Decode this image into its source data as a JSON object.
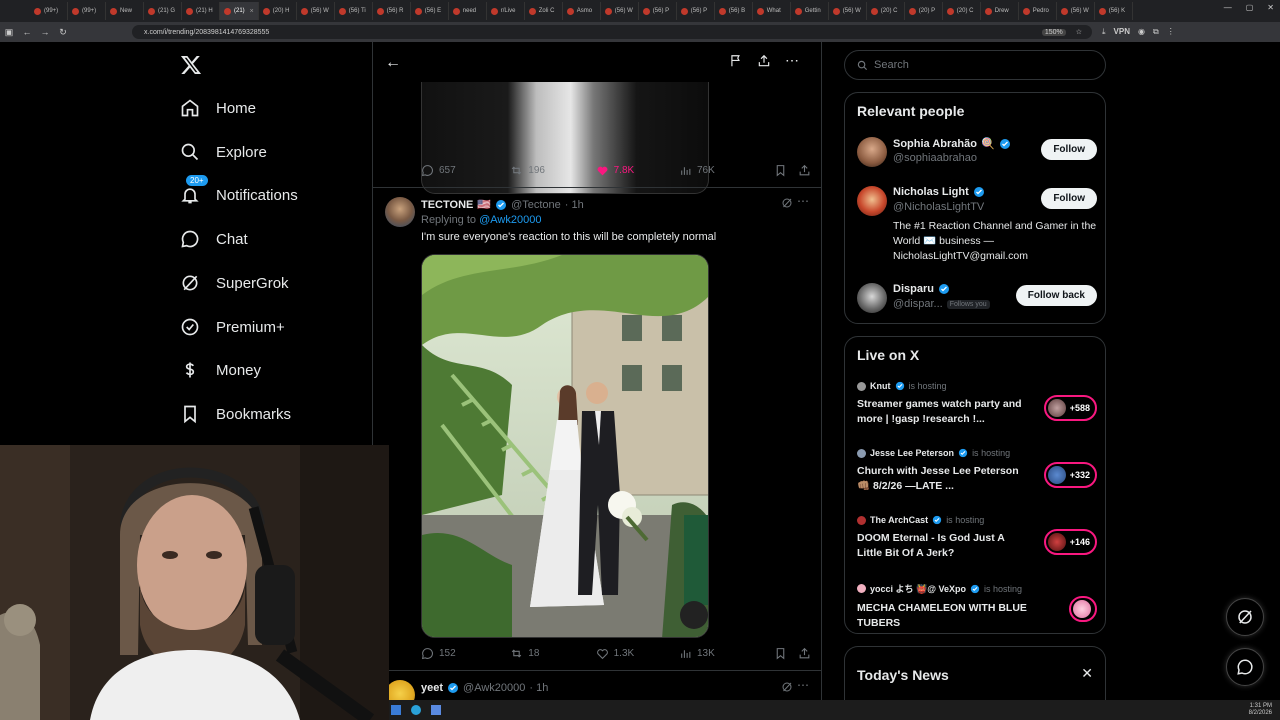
{
  "browser": {
    "tabs": [
      {
        "label": "(99+)"
      },
      {
        "label": "(99+)"
      },
      {
        "label": "New"
      },
      {
        "label": "(21) G"
      },
      {
        "label": "(21) H"
      },
      {
        "label": "(21)",
        "active": true
      },
      {
        "label": "(20) H"
      },
      {
        "label": "(56) W"
      },
      {
        "label": "(56) Ti"
      },
      {
        "label": "(56) R"
      },
      {
        "label": "(56) E"
      },
      {
        "label": "need"
      },
      {
        "label": "r/Live"
      },
      {
        "label": "Zoli C"
      },
      {
        "label": "Asmo"
      },
      {
        "label": "(56) W"
      },
      {
        "label": "(56) P"
      },
      {
        "label": "(56) P"
      },
      {
        "label": "(56) B"
      },
      {
        "label": "What"
      },
      {
        "label": "Gettin"
      },
      {
        "label": "(56) W"
      },
      {
        "label": "(20) C"
      },
      {
        "label": "(20) P"
      },
      {
        "label": "(20) C"
      },
      {
        "label": "Drew"
      },
      {
        "label": "Pedro"
      },
      {
        "label": "(56) W"
      },
      {
        "label": "(56) K"
      }
    ],
    "url": "x.com/i/trending/2083981414769328555",
    "zoom": "150%",
    "vpn": "VPN"
  },
  "nav": {
    "items": [
      {
        "label": "Home",
        "icon": "home-icon"
      },
      {
        "label": "Explore",
        "icon": "search-icon"
      },
      {
        "label": "Notifications",
        "icon": "bell-icon",
        "badge": "20+"
      },
      {
        "label": "Chat",
        "icon": "chat-icon"
      },
      {
        "label": "SuperGrok",
        "icon": "grok-icon"
      },
      {
        "label": "Premium+",
        "icon": "premium-icon"
      },
      {
        "label": "Money",
        "icon": "money-icon"
      },
      {
        "label": "Bookmarks",
        "icon": "bookmark-icon"
      }
    ]
  },
  "tweet1": {
    "replies": "657",
    "reposts": "196",
    "likes": "7.8K",
    "views": "76K"
  },
  "tweet2": {
    "name": "TECTONE",
    "flag": "🇺🇸",
    "handle": "@Tectone",
    "time": "· 1h",
    "replying_prefix": "Replying to",
    "replying_to": "@Awk20000",
    "text": "I'm sure everyone's reaction to this will be completely normal",
    "replies": "152",
    "reposts": "18",
    "likes": "1.3K",
    "views": "13K"
  },
  "tweet3": {
    "name": "yeet",
    "handle": "@Awk20000",
    "time": "· 1h"
  },
  "search": {
    "placeholder": "Search"
  },
  "relevant": {
    "title": "Relevant people",
    "people": [
      {
        "name": "Sophia Abrahão",
        "emoji": "🍭",
        "handle": "@sophiaabrahao",
        "button": "Follow"
      },
      {
        "name": "Nicholas Light",
        "handle": "@NicholasLightTV",
        "bio": "The #1 Reaction Channel and Gamer in the World ✉️ business — NicholasLightTV@gmail.com",
        "button": "Follow"
      },
      {
        "name": "Disparu",
        "handle": "@dispar...",
        "follows_you": "Follows you",
        "button": "Follow back"
      }
    ]
  },
  "live": {
    "title": "Live on X",
    "host_label": "is hosting",
    "items": [
      {
        "host": "Knut",
        "title": "Streamer games watch party and more | !gasp !research !...",
        "count": "+588"
      },
      {
        "host": "Jesse Lee Peterson",
        "title": "Church with Jesse Lee Peterson 👊🏽 8/2/26 —LATE ...",
        "count": "+332"
      },
      {
        "host": "The ArchCast",
        "title": "DOOM Eternal - Is God Just A Little Bit Of A Jerk?",
        "count": "+146"
      },
      {
        "host": "yocci よち 👹@ VeXpo",
        "title": "MECHA CHAMELEON WITH BLUE TUBERS",
        "count": ""
      }
    ]
  },
  "news": {
    "title": "Today's News"
  },
  "taskbar": {
    "time": "1:31 PM",
    "date": "8/2/2026"
  },
  "colors": {
    "accent": "#1d9bf0",
    "like": "#f91880",
    "bg": "#000000",
    "muted": "#71767b"
  }
}
